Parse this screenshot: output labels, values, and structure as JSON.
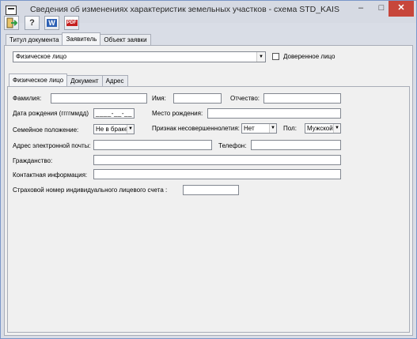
{
  "window": {
    "title": "Сведения об изменениях характеристик земельных участков - схема STD_KAIS",
    "minimize": "–",
    "maximize": "□",
    "close": "✕"
  },
  "toolbar": {
    "help_glyph": "?",
    "word_glyph": "W",
    "pdf_glyph": "PDF"
  },
  "main_tabs": [
    "Титул документа",
    "Заявитель",
    "Объект заявки"
  ],
  "applicant": {
    "type_value": "Физическое лицо",
    "trusted_label": "Доверенное лицо"
  },
  "inner_tabs": [
    "Физическое лицо",
    "Документ",
    "Адрес"
  ],
  "form": {
    "surname": "Фамилия:",
    "name": "Имя:",
    "patronymic": "Отчество:",
    "birth_date": "Дата рождения (ггггммдд)",
    "birth_date_value": "____-__-__",
    "birth_place": "Место рождения:",
    "marital_status": "Семейное положение:",
    "marital_value": "Не в браке",
    "minor_flag": "Признак несовершеннолетия:",
    "minor_value": "Нет",
    "gender": "Пол:",
    "gender_value": "Мужской",
    "email": "Адрес электронной почты:",
    "phone": "Телефон:",
    "citizenship": "Гражданство:",
    "contact": "Контактная информация:",
    "snils": "Страховой номер индивидуального лицевого счета :"
  }
}
